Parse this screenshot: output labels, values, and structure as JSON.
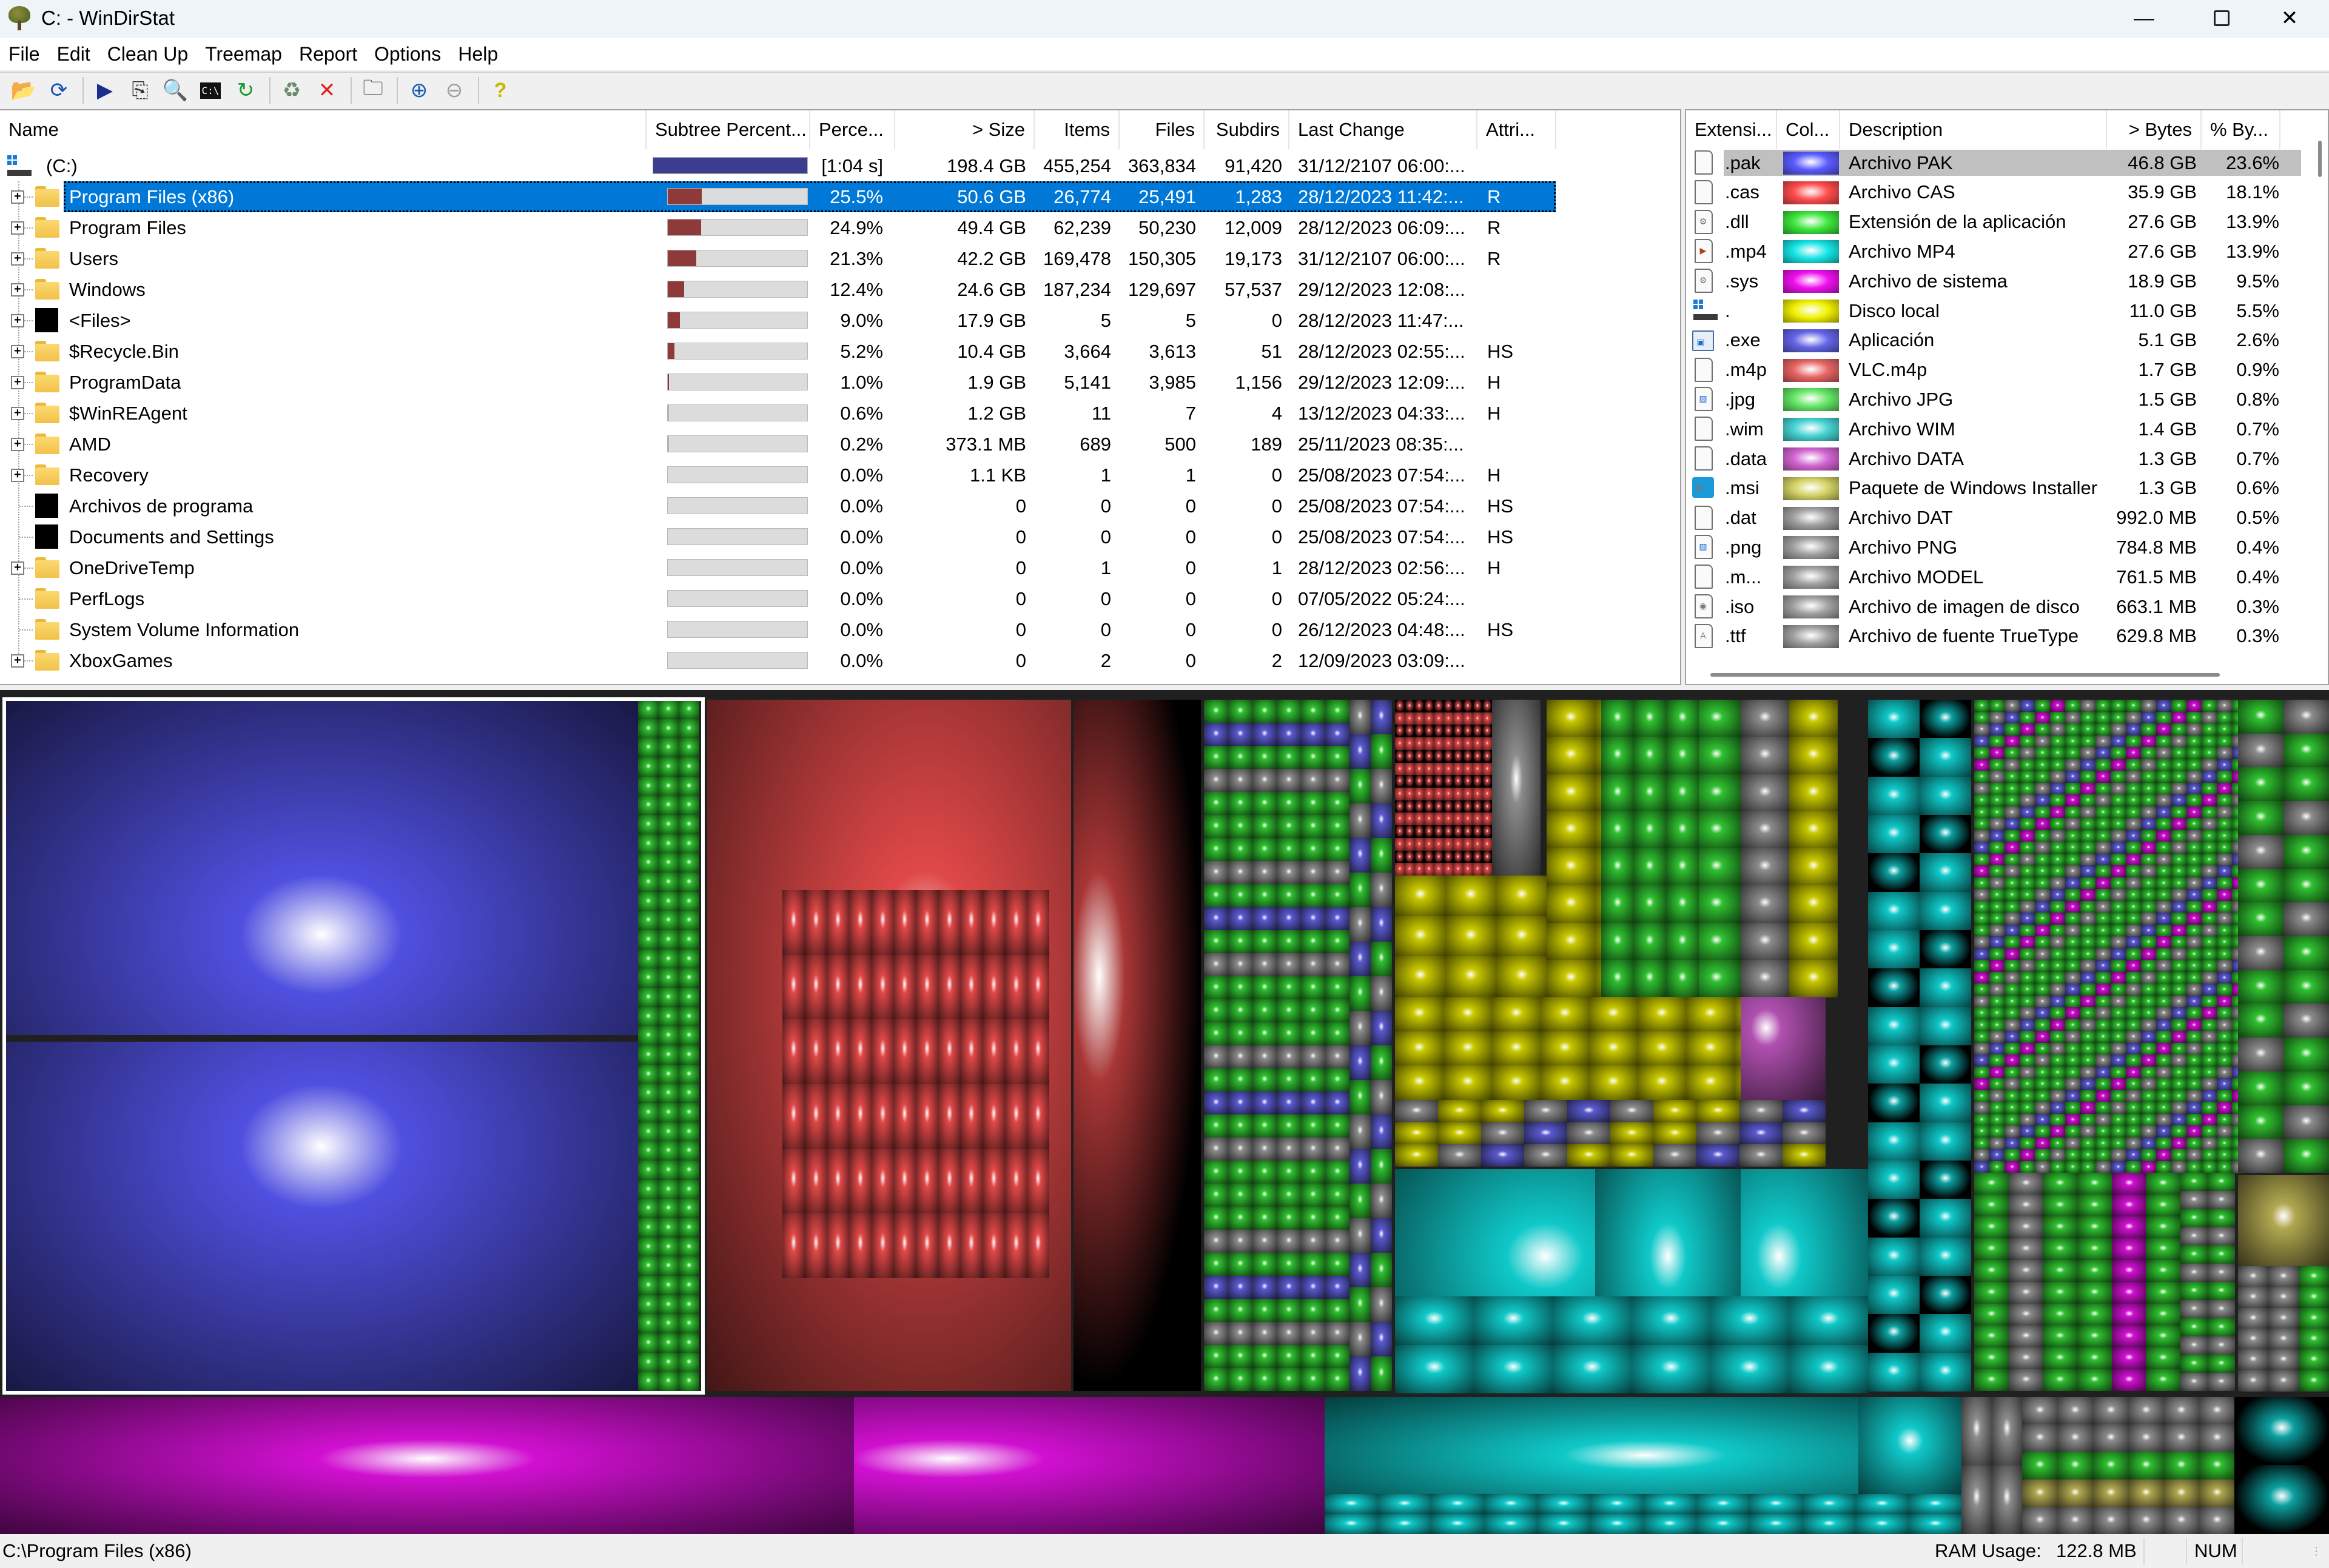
{
  "window": {
    "title": "C: - WinDirStat",
    "controls": [
      "minimize",
      "maximize",
      "close"
    ]
  },
  "menu": [
    "File",
    "Edit",
    "Clean Up",
    "Treemap",
    "Report",
    "Options",
    "Help"
  ],
  "toolbar": {
    "groups": [
      [
        {
          "name": "open-icon",
          "glyph": "📂"
        },
        {
          "name": "rescan-icon",
          "glyph": "⟳"
        }
      ],
      [
        {
          "name": "open-item-icon",
          "glyph": "▶"
        },
        {
          "name": "copy-path-icon",
          "glyph": "⎘"
        },
        {
          "name": "explorer-here-icon",
          "glyph": "🔍"
        },
        {
          "name": "command-prompt-icon",
          "glyph": "C:\\"
        },
        {
          "name": "refresh-icon",
          "glyph": "↻"
        }
      ],
      [
        {
          "name": "recycle-bin-icon",
          "glyph": "♻"
        },
        {
          "name": "delete-icon",
          "glyph": "✕"
        }
      ],
      [
        {
          "name": "properties-icon",
          "glyph": "🗀"
        }
      ],
      [
        {
          "name": "zoom-in-icon",
          "glyph": "⊕"
        },
        {
          "name": "zoom-out-icon",
          "glyph": "⊖"
        }
      ],
      [
        {
          "name": "help-icon",
          "glyph": "?"
        }
      ]
    ]
  },
  "tree": {
    "columns": [
      "Name",
      "Subtree Percent...",
      "Perce...",
      "> Size",
      "Items",
      "Files",
      "Subdirs",
      "Last Change",
      "Attri..."
    ],
    "root": {
      "name": "(C:)",
      "subtree_fraction": 1.0,
      "percent": "[1:04 s]",
      "size": "198.4 GB",
      "items": "455,254",
      "files": "363,834",
      "subdirs": "91,420",
      "last_change": "31/12/2107  06:00:...",
      "attributes": ""
    },
    "rows": [
      {
        "name": "Program Files (x86)",
        "icon": "folder",
        "expandable": true,
        "selected": true,
        "subtree_fraction": 0.255,
        "percent": "25.5%",
        "size": "50.6 GB",
        "items": "26,774",
        "files": "25,491",
        "subdirs": "1,283",
        "last_change": "28/12/2023  11:42:...",
        "attributes": "R"
      },
      {
        "name": "Program Files",
        "icon": "folder",
        "expandable": true,
        "subtree_fraction": 0.249,
        "percent": "24.9%",
        "size": "49.4 GB",
        "items": "62,239",
        "files": "50,230",
        "subdirs": "12,009",
        "last_change": "28/12/2023  06:09:...",
        "attributes": "R"
      },
      {
        "name": "Users",
        "icon": "folder",
        "expandable": true,
        "subtree_fraction": 0.213,
        "percent": "21.3%",
        "size": "42.2 GB",
        "items": "169,478",
        "files": "150,305",
        "subdirs": "19,173",
        "last_change": "31/12/2107  06:00:...",
        "attributes": "R"
      },
      {
        "name": "Windows",
        "icon": "folder",
        "expandable": true,
        "subtree_fraction": 0.124,
        "percent": "12.4%",
        "size": "24.6 GB",
        "items": "187,234",
        "files": "129,697",
        "subdirs": "57,537",
        "last_change": "29/12/2023  12:08:...",
        "attributes": ""
      },
      {
        "name": "<Files>",
        "icon": "files",
        "expandable": true,
        "subtree_fraction": 0.09,
        "percent": "9.0%",
        "size": "17.9 GB",
        "items": "5",
        "files": "5",
        "subdirs": "0",
        "last_change": "28/12/2023  11:47:...",
        "attributes": ""
      },
      {
        "name": "$Recycle.Bin",
        "icon": "folder",
        "expandable": true,
        "subtree_fraction": 0.052,
        "percent": "5.2%",
        "size": "10.4 GB",
        "items": "3,664",
        "files": "3,613",
        "subdirs": "51",
        "last_change": "28/12/2023  02:55:...",
        "attributes": "HS"
      },
      {
        "name": "ProgramData",
        "icon": "folder",
        "expandable": true,
        "subtree_fraction": 0.01,
        "percent": "1.0%",
        "size": "1.9 GB",
        "items": "5,141",
        "files": "3,985",
        "subdirs": "1,156",
        "last_change": "29/12/2023  12:09:...",
        "attributes": "H"
      },
      {
        "name": "$WinREAgent",
        "icon": "folder",
        "expandable": true,
        "subtree_fraction": 0.006,
        "percent": "0.6%",
        "size": "1.2 GB",
        "items": "11",
        "files": "7",
        "subdirs": "4",
        "last_change": "13/12/2023  04:33:...",
        "attributes": "H"
      },
      {
        "name": "AMD",
        "icon": "folder",
        "expandable": true,
        "subtree_fraction": 0.002,
        "percent": "0.2%",
        "size": "373.1 MB",
        "items": "689",
        "files": "500",
        "subdirs": "189",
        "last_change": "25/11/2023  08:35:...",
        "attributes": ""
      },
      {
        "name": "Recovery",
        "icon": "folder",
        "expandable": true,
        "subtree_fraction": 0.0,
        "percent": "0.0%",
        "size": "1.1 KB",
        "items": "1",
        "files": "1",
        "subdirs": "0",
        "last_change": "25/08/2023  07:54:...",
        "attributes": "H"
      },
      {
        "name": "Archivos de programa",
        "icon": "junction",
        "expandable": false,
        "subtree_fraction": 0.0,
        "percent": "0.0%",
        "size": "0",
        "items": "0",
        "files": "0",
        "subdirs": "0",
        "last_change": "25/08/2023  07:54:...",
        "attributes": "HS"
      },
      {
        "name": "Documents and Settings",
        "icon": "junction",
        "expandable": false,
        "subtree_fraction": 0.0,
        "percent": "0.0%",
        "size": "0",
        "items": "0",
        "files": "0",
        "subdirs": "0",
        "last_change": "25/08/2023  07:54:...",
        "attributes": "HS"
      },
      {
        "name": "OneDriveTemp",
        "icon": "folder",
        "expandable": true,
        "subtree_fraction": 0.0,
        "percent": "0.0%",
        "size": "0",
        "items": "1",
        "files": "0",
        "subdirs": "1",
        "last_change": "28/12/2023  02:56:...",
        "attributes": "H"
      },
      {
        "name": "PerfLogs",
        "icon": "folder",
        "expandable": false,
        "subtree_fraction": 0.0,
        "percent": "0.0%",
        "size": "0",
        "items": "0",
        "files": "0",
        "subdirs": "0",
        "last_change": "07/05/2022  05:24:...",
        "attributes": ""
      },
      {
        "name": "System Volume Information",
        "icon": "folder",
        "expandable": false,
        "subtree_fraction": 0.0,
        "percent": "0.0%",
        "size": "0",
        "items": "0",
        "files": "0",
        "subdirs": "0",
        "last_change": "26/12/2023  04:48:...",
        "attributes": "HS"
      },
      {
        "name": "XboxGames",
        "icon": "folder",
        "expandable": true,
        "subtree_fraction": 0.0,
        "percent": "0.0%",
        "size": "0",
        "items": "2",
        "files": "0",
        "subdirs": "2",
        "last_change": "12/09/2023  03:09:...",
        "attributes": ""
      }
    ]
  },
  "extensions": {
    "columns": [
      "Extensi...",
      "Col...",
      "Description",
      "> Bytes",
      "% By..."
    ],
    "rows": [
      {
        "ext": ".pak",
        "color": "#5a5aff",
        "description": "Archivo PAK",
        "bytes": "46.8 GB",
        "percent": "23.6%",
        "icon": "blank",
        "selected": true
      },
      {
        "ext": ".cas",
        "color": "#ff4c4c",
        "description": "Archivo CAS",
        "bytes": "35.9 GB",
        "percent": "18.1%",
        "icon": "blank"
      },
      {
        "ext": ".dll",
        "color": "#3ce63c",
        "description": "Extensión de la aplicación",
        "bytes": "27.6 GB",
        "percent": "13.9%",
        "icon": "gear"
      },
      {
        "ext": ".mp4",
        "color": "#16e4e4",
        "description": "Archivo MP4",
        "bytes": "27.6 GB",
        "percent": "13.9%",
        "icon": "media"
      },
      {
        "ext": ".sys",
        "color": "#ee10ee",
        "description": "Archivo de sistema",
        "bytes": "18.9 GB",
        "percent": "9.5%",
        "icon": "gear"
      },
      {
        "ext": ".",
        "color": "#f0f000",
        "description": "Disco local",
        "bytes": "11.0 GB",
        "percent": "5.5%",
        "icon": "drive"
      },
      {
        "ext": ".exe",
        "color": "#6464e6",
        "description": "Aplicación",
        "bytes": "5.1 GB",
        "percent": "2.6%",
        "icon": "exe"
      },
      {
        "ext": ".m4p",
        "color": "#e66464",
        "description": "VLC.m4p",
        "bytes": "1.7 GB",
        "percent": "0.9%",
        "icon": "blank"
      },
      {
        "ext": ".jpg",
        "color": "#64e664",
        "description": "Archivo JPG",
        "bytes": "1.5 GB",
        "percent": "0.8%",
        "icon": "image"
      },
      {
        "ext": ".wim",
        "color": "#46d2d2",
        "description": "Archivo WIM",
        "bytes": "1.4 GB",
        "percent": "0.7%",
        "icon": "blank"
      },
      {
        "ext": ".data",
        "color": "#d264d2",
        "description": "Archivo DATA",
        "bytes": "1.3 GB",
        "percent": "0.7%",
        "icon": "blank"
      },
      {
        "ext": ".msi",
        "color": "#d2d264",
        "description": "Paquete de Windows Installer",
        "bytes": "1.3 GB",
        "percent": "0.6%",
        "icon": "msi"
      },
      {
        "ext": ".dat",
        "color": "#a0a0a0",
        "description": "Archivo DAT",
        "bytes": "992.0 MB",
        "percent": "0.5%",
        "icon": "blank"
      },
      {
        "ext": ".png",
        "color": "#a0a0a0",
        "description": "Archivo PNG",
        "bytes": "784.8 MB",
        "percent": "0.4%",
        "icon": "image"
      },
      {
        "ext": ".m...",
        "color": "#a0a0a0",
        "description": "Archivo MODEL",
        "bytes": "761.5 MB",
        "percent": "0.4%",
        "icon": "blank"
      },
      {
        "ext": ".iso",
        "color": "#a0a0a0",
        "description": "Archivo de imagen de disco",
        "bytes": "663.1 MB",
        "percent": "0.3%",
        "icon": "disc"
      },
      {
        "ext": ".ttf",
        "color": "#a0a0a0",
        "description": "Archivo de fuente TrueType",
        "bytes": "629.8 MB",
        "percent": "0.3%",
        "icon": "font"
      }
    ]
  },
  "treemap": {
    "selected": "Program Files (x86)",
    "colors": {
      "pak": "#5050e0",
      "cas": "#e04848",
      "dll": "#30c030",
      "mp4": "#10c8c8",
      "sys": "#d010d0",
      "none": "#c8c800",
      "exe": "#5a5ad0",
      "msi": "#b0a850",
      "other": "#8c8c8c",
      "data": "#b050b0"
    }
  },
  "status": {
    "path": "C:\\Program Files (x86)",
    "ram_label": "RAM Usage:",
    "ram_value": "122.8 MB",
    "num": "NUM"
  },
  "colors": {
    "selection": "#0078d7",
    "subtree_bar": "#8f3a3a",
    "root_bar": "#3c3c90"
  }
}
